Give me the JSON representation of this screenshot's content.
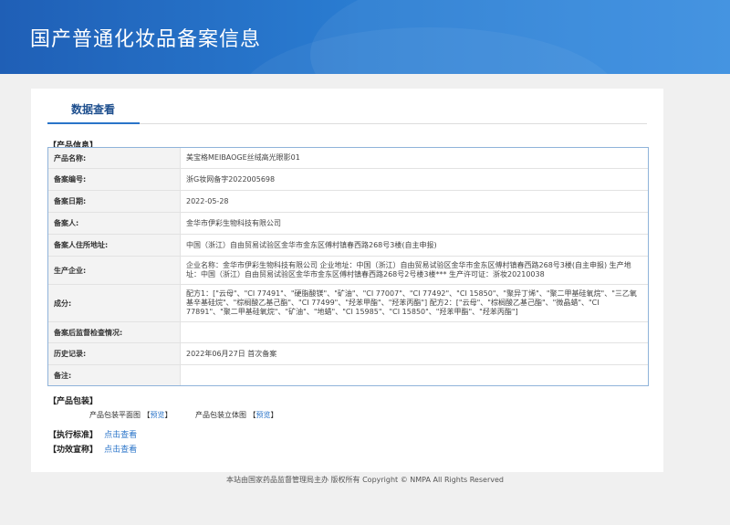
{
  "header": {
    "title": "国产普通化妆品备案信息"
  },
  "tabs": [
    {
      "label": "数据查看"
    }
  ],
  "product_info": {
    "section_title": "【产品信息】",
    "rows": [
      {
        "label": "产品名称:",
        "value": "美宝格MEIBAOGE丝绒高光眼影01"
      },
      {
        "label": "备案编号:",
        "value": "浙G妆网备字2022005698"
      },
      {
        "label": "备案日期:",
        "value": "2022-05-28"
      },
      {
        "label": "备案人:",
        "value": "金华市伊彩生物科技有限公司"
      },
      {
        "label": "备案人住所地址:",
        "value": "中国（浙江）自由贸易试验区金华市金东区傅村镇春西路268号3楼(自主申报)"
      },
      {
        "label": "生产企业:",
        "value": "企业名称：金华市伊彩生物科技有限公司 企业地址：中国（浙江）自由贸易试验区金华市金东区傅村镇春西路268号3楼(自主申报) 生产地址：中国（浙江）自由贸易试验区金华市金东区傅村镇春西路268号2号楼3楼*** 生产许可证：浙妆20210038"
      },
      {
        "label": "成分:",
        "value": "配方1：[\"云母\"、\"CI 77491\"、\"硬脂酸镁\"、\"矿油\"、\"CI 77007\"、\"CI 77492\"、\"CI 15850\"、\"聚异丁烯\"、\"聚二甲基硅氧烷\"、\"三乙氧基辛基硅烷\"、\"棕榈酸乙基己酯\"、\"CI 77499\"、\"羟苯甲酯\"、\"羟苯丙酯\"] 配方2：[\"云母\"、\"棕榈酸乙基己酯\"、\"微晶蜡\"、\"CI 77891\"、\"聚二甲基硅氧烷\"、\"矿油\"、\"地蜡\"、\"CI 15985\"、\"CI 15850\"、\"羟苯甲酯\"、\"羟苯丙酯\"]"
      },
      {
        "label": "备案后监督检查情况:",
        "value": ""
      },
      {
        "label": "历史记录:",
        "value": "2022年06月27日 首次备案"
      },
      {
        "label": "备注:",
        "value": ""
      }
    ]
  },
  "packaging": {
    "section_title": "【产品包装】",
    "flat_label": "产品包装平面图",
    "solid_label": "产品包装立体图",
    "preview_open": "【",
    "preview_link": "预览",
    "preview_close": "】"
  },
  "standards": {
    "section_title": "【执行标准】",
    "link": "点击查看"
  },
  "efficacy": {
    "section_title": "【功效宣称】",
    "link": "点击查看"
  },
  "footer": {
    "text": "本站由国家药品监督管理局主办 版权所有 Copyright © NMPA All Rights Reserved"
  }
}
